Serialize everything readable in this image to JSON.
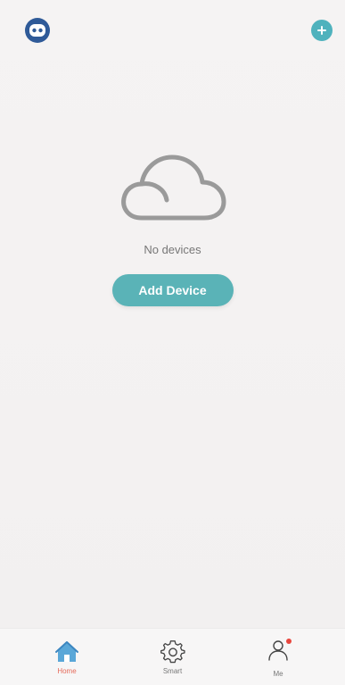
{
  "topbar": {
    "assistant_icon": "robot-assistant-icon",
    "add_icon": "plus-icon"
  },
  "empty_state": {
    "icon": "cloud-icon",
    "message": "No devices",
    "button_label": "Add Device"
  },
  "tabbar": {
    "tabs": [
      {
        "label": "Home",
        "icon": "home-icon",
        "active": true
      },
      {
        "label": "Smart",
        "icon": "gear-icon",
        "active": false
      },
      {
        "label": "Me",
        "icon": "person-icon",
        "active": false
      }
    ]
  },
  "colors": {
    "accent": "#5ab3b7",
    "active_tab": "#e56a5a",
    "assistant": "#2f5a98"
  }
}
